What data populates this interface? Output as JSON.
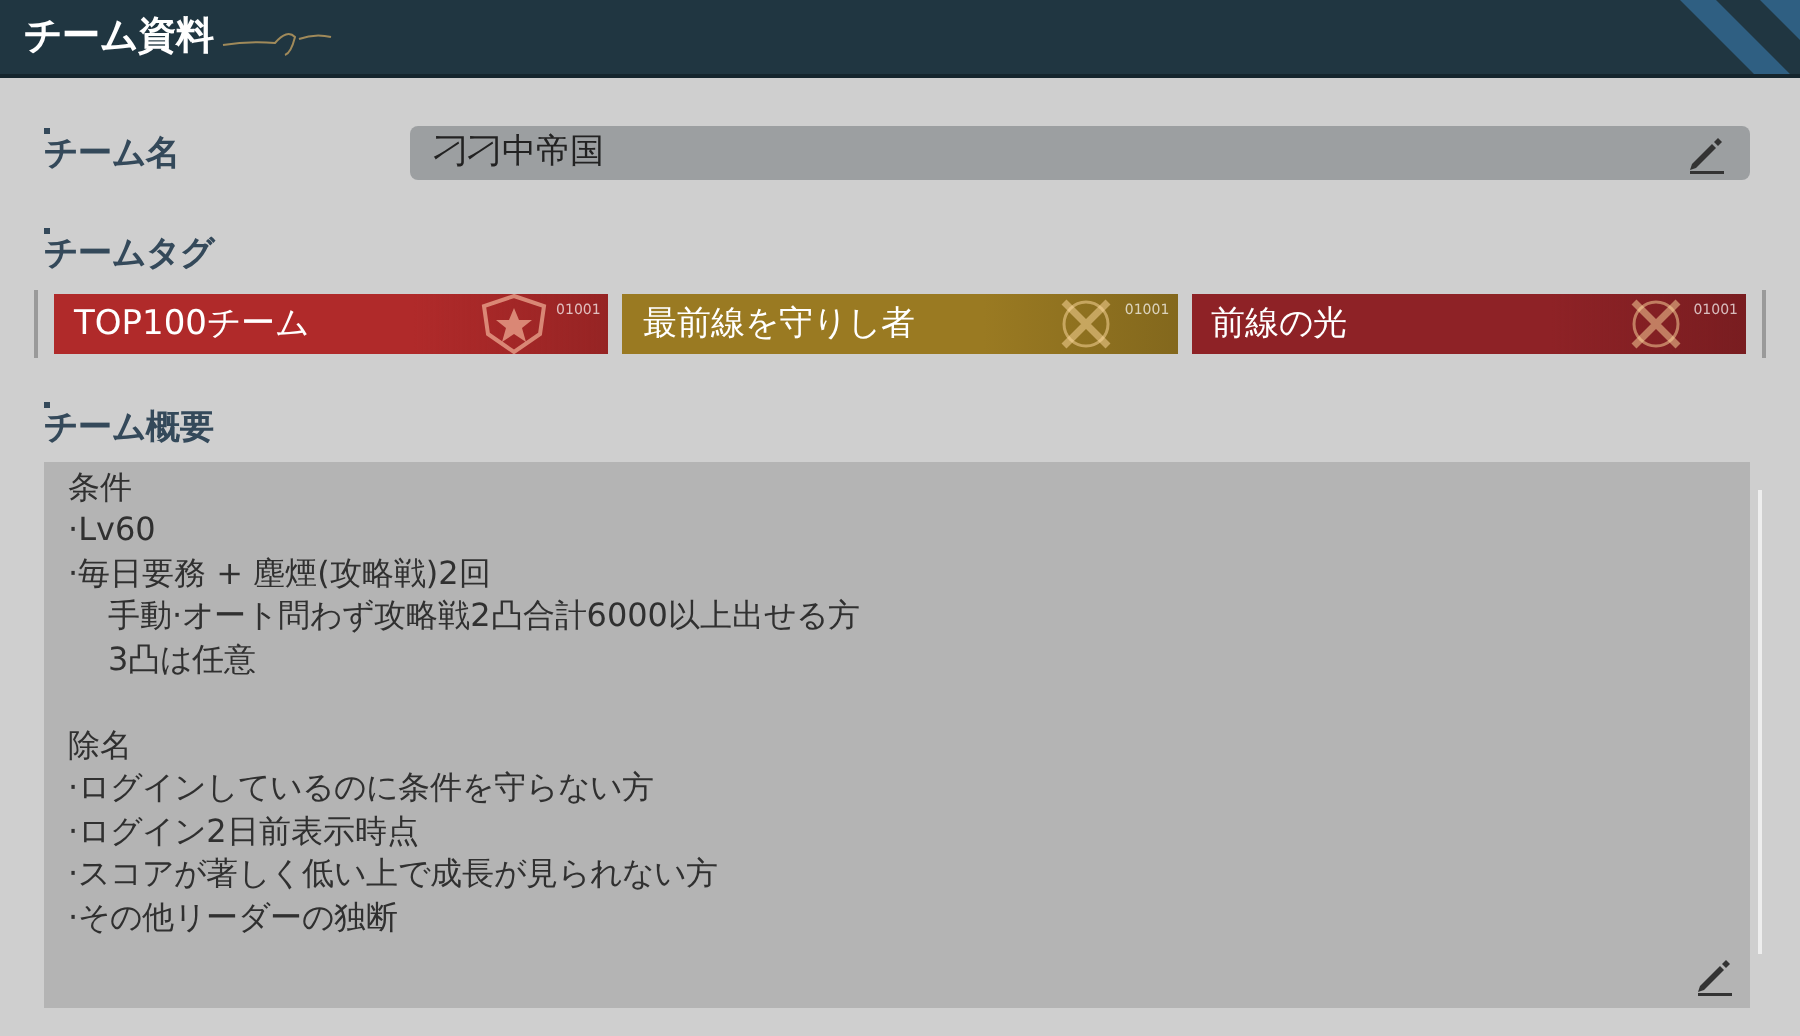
{
  "window": {
    "title": "チーム資料"
  },
  "team_name": {
    "label": "チーム名",
    "value": "刁刁中帝国"
  },
  "team_tags": {
    "label": "チームタグ",
    "tags": [
      {
        "label": "TOP100チーム",
        "code": "01001",
        "color": "#b02a2a",
        "kind": "shield"
      },
      {
        "label": "最前線を守りし者",
        "code": "01001",
        "color": "#9a7a22",
        "kind": "swords"
      },
      {
        "label": "前線の光",
        "code": "01001",
        "color": "#8e2226",
        "kind": "swords"
      }
    ]
  },
  "team_summary": {
    "label": "チーム概要",
    "sections": [
      {
        "heading": "条件",
        "lines": [
          {
            "text": "·Lv60",
            "indent": false
          },
          {
            "text": "·毎日要務 + 塵煙(攻略戦)2回",
            "indent": false
          },
          {
            "text": "手動·オート問わず攻略戦2凸合計6000以上出せる方",
            "indent": true
          },
          {
            "text": "3凸は任意",
            "indent": true
          }
        ]
      },
      {
        "heading": "除名",
        "lines": [
          {
            "text": "·ログインしているのに条件を守らない方",
            "indent": false
          },
          {
            "text": "·ログイン2日前表示時点",
            "indent": false
          },
          {
            "text": "·スコアが著しく低い上で成長が見られない方",
            "indent": false
          },
          {
            "text": "·その他リーダーの独断",
            "indent": false
          }
        ]
      }
    ]
  }
}
